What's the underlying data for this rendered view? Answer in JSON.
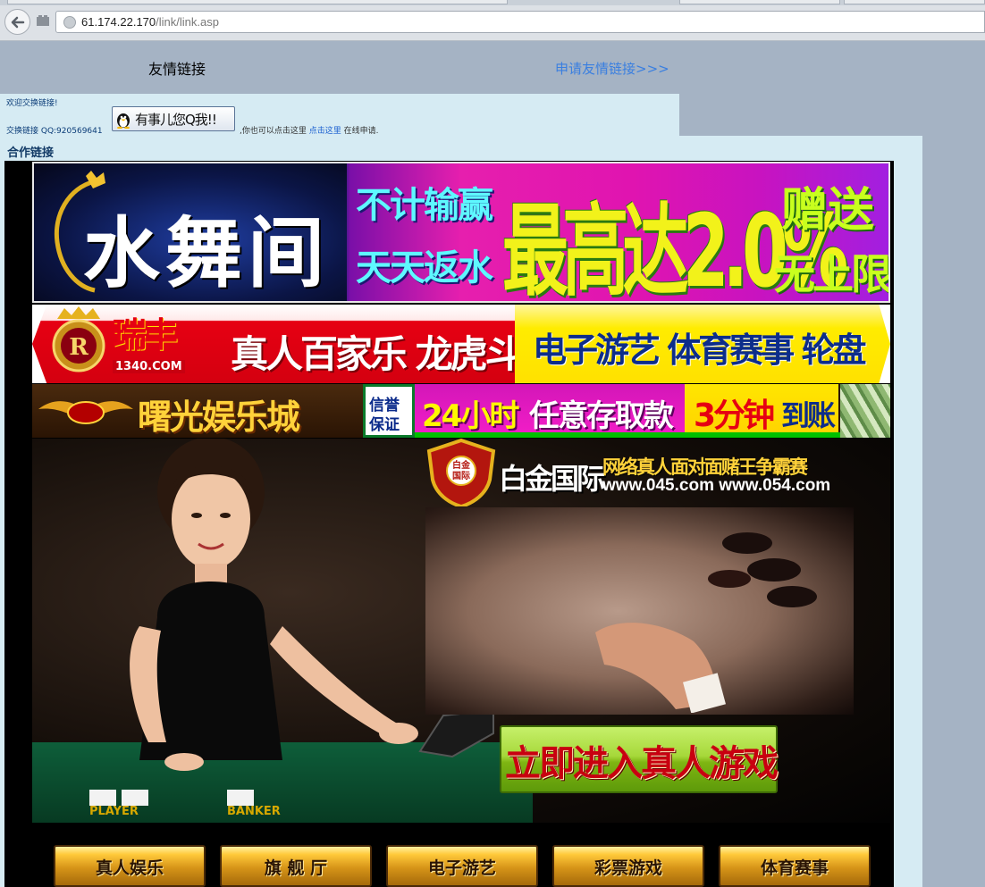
{
  "browser": {
    "url_host": "61.174.22.170",
    "url_path": "/link/link.asp"
  },
  "page": {
    "title": "友情链接",
    "apply_link": "申请友情链接>>>"
  },
  "info": {
    "welcome": "欢迎交换链接!",
    "exchange_label": "交换链接 QQ:920569641",
    "qq_button": "有事儿您Q我!!",
    "online_prefix": ",你也可以点击这里",
    "online_link": "点击这里",
    "online_suffix": "在线申请."
  },
  "coop": {
    "title": "合作链接"
  },
  "banners": {
    "b1": {
      "logo_text": "水舞间",
      "line_a": "不计输赢",
      "line_b": "天天返水",
      "big": "最高达2.0%",
      "gift": "赠送",
      "unlimited": "无上限"
    },
    "b2": {
      "brand": "瑞丰",
      "brand_num": "1340.COM",
      "games_left": "真人百家乐 龙虎斗",
      "games_right": "电子游艺 体育赛事 轮盘"
    },
    "b3": {
      "brand": "曙光娱乐城",
      "trust_top": "信誉",
      "trust_bottom": "保证",
      "deposit_a": "24小时",
      "deposit_b": "任意存取款",
      "fast_a": "3分钟",
      "fast_b": "到账"
    },
    "b4": {
      "logo_text": "白金国际",
      "slogan": "网络真人面对面赌王争霸赛",
      "sites": "www.045.com  www.054.com",
      "player": "PLAYER",
      "banker": "BANKER",
      "cta": "立即进入真人游戏"
    }
  },
  "menu": [
    {
      "label": "真人娱乐"
    },
    {
      "label": "旗 舰 厅"
    },
    {
      "label": "电子游艺"
    },
    {
      "label": "彩票游戏"
    },
    {
      "label": "体育赛事"
    }
  ]
}
